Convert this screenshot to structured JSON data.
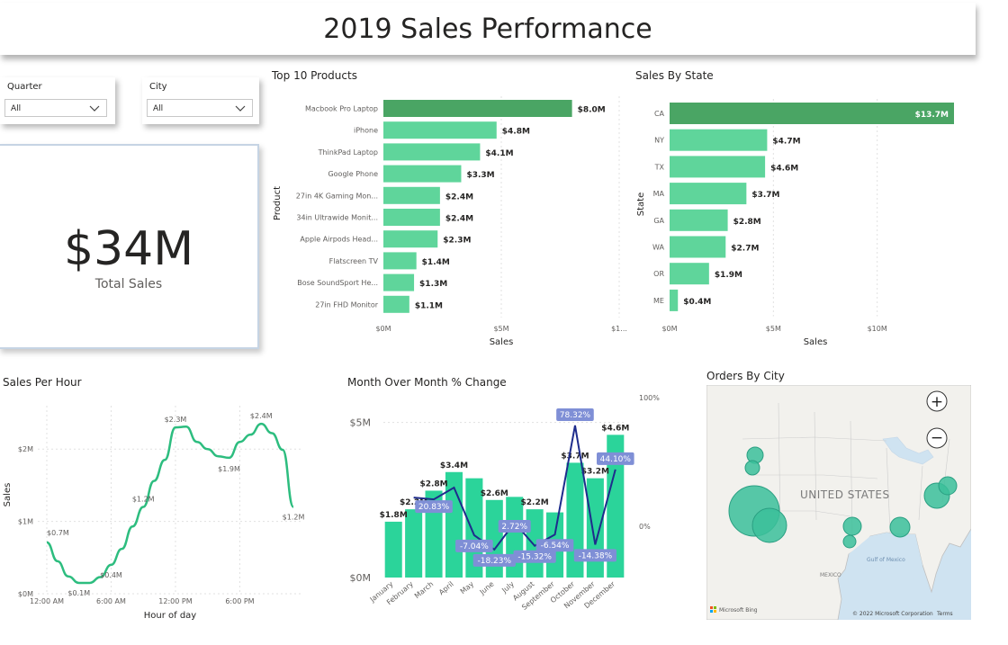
{
  "header": {
    "title": "2019 Sales Performance"
  },
  "slicers": [
    {
      "label": "Quarter",
      "value": "All"
    },
    {
      "label": "City",
      "value": "All"
    }
  ],
  "kpi": {
    "value": "$34M",
    "label": "Total Sales"
  },
  "colors": {
    "top_bar": "#4aa564",
    "bar": "#5fd59b",
    "line": "#2dbd7f",
    "mom_bar": "#2bd49a",
    "mom_line": "#1e2c8c",
    "tag_bg": "#7f8fd6",
    "bubble": "#3bbf9a"
  },
  "chart_data": [
    {
      "type": "bar",
      "orientation": "horizontal",
      "title": "Top 10 Products",
      "xlabel": "Sales",
      "ylabel": "Product",
      "categories": [
        "Macbook Pro Laptop",
        "iPhone",
        "ThinkPad Laptop",
        "Google Phone",
        "27in 4K Gaming Mon...",
        "34in Ultrawide Monit...",
        "Apple Airpods Head...",
        "Flatscreen TV",
        "Bose SoundSport He...",
        "27in FHD Monitor"
      ],
      "values": [
        8.0,
        4.8,
        4.1,
        3.3,
        2.4,
        2.4,
        2.3,
        1.4,
        1.3,
        1.1
      ],
      "data_labels": [
        "$8.0M",
        "$4.8M",
        "$4.1M",
        "$3.3M",
        "$2.4M",
        "$2.4M",
        "$2.3M",
        "$1.4M",
        "$1.3M",
        "$1.1M"
      ],
      "xticks": [
        "$0M",
        "$5M",
        "$1..."
      ],
      "xlim": [
        0,
        10
      ]
    },
    {
      "type": "bar",
      "orientation": "horizontal",
      "title": "Sales By State",
      "xlabel": "Sales",
      "ylabel": "State",
      "categories": [
        "CA",
        "NY",
        "TX",
        "MA",
        "GA",
        "WA",
        "OR",
        "ME"
      ],
      "values": [
        13.7,
        4.7,
        4.6,
        3.7,
        2.8,
        2.7,
        1.9,
        0.4
      ],
      "data_labels": [
        "$13.7M",
        "$4.7M",
        "$4.6M",
        "$3.7M",
        "$2.8M",
        "$2.7M",
        "$1.9M",
        "$0.4M"
      ],
      "xticks": [
        "$0M",
        "$5M",
        "$10M"
      ],
      "xlim": [
        0,
        13.7
      ]
    },
    {
      "type": "line",
      "title": "Sales Per Hour",
      "xlabel": "Hour of day",
      "ylabel": "Sales",
      "x": [
        0,
        1,
        2,
        3,
        4,
        5,
        6,
        7,
        8,
        9,
        10,
        11,
        12,
        13,
        14,
        15,
        16,
        17,
        18,
        19,
        20,
        21,
        22,
        23
      ],
      "values": [
        0.71,
        0.45,
        0.24,
        0.15,
        0.15,
        0.23,
        0.4,
        0.62,
        0.93,
        1.2,
        1.56,
        1.85,
        2.3,
        2.31,
        2.1,
        2.0,
        1.9,
        1.88,
        2.1,
        2.2,
        2.35,
        2.22,
        1.99,
        1.2
      ],
      "point_labels": [
        {
          "x": 0,
          "label": "$0.7M"
        },
        {
          "x": 3,
          "label": "$0.1M"
        },
        {
          "x": 6,
          "label": "$0.4M"
        },
        {
          "x": 9,
          "label": "$1.2M"
        },
        {
          "x": 12,
          "label": "$2.3M"
        },
        {
          "x": 17,
          "label": "$1.9M"
        },
        {
          "x": 20,
          "label": "$2.4M"
        },
        {
          "x": 23,
          "label": "$1.2M"
        }
      ],
      "xticks": [
        "12:00 AM",
        "6:00 AM",
        "12:00 PM",
        "6:00 PM"
      ],
      "yticks": [
        "$0M",
        "$1M",
        "$2M"
      ],
      "ylim": [
        0,
        2.6
      ]
    },
    {
      "type": "bar",
      "title": "Month Over Month % Change",
      "categories": [
        "January",
        "February",
        "March",
        "April",
        "May",
        "June",
        "July",
        "August",
        "September",
        "October",
        "November",
        "December"
      ],
      "values": [
        1.8,
        2.2,
        2.8,
        3.4,
        3.2,
        2.5,
        2.6,
        2.2,
        2.1,
        3.7,
        3.2,
        4.6
      ],
      "data_labels": [
        {
          "month": "January",
          "label": "$1.8M"
        },
        {
          "month": "February",
          "label": "$2.2M"
        },
        {
          "month": "March",
          "label": "$2.8M"
        },
        {
          "month": "April",
          "label": "$3.4M"
        },
        {
          "month": "June",
          "label": "$2.6M"
        },
        {
          "month": "August",
          "label": "$2.2M"
        },
        {
          "month": "October",
          "label": "$3.7M"
        },
        {
          "month": "November",
          "label": "$3.2M"
        },
        {
          "month": "December",
          "label": "$4.6M"
        }
      ],
      "ylim": [
        0,
        5.8
      ],
      "yticks": [
        "$0M",
        "$5M"
      ],
      "line_series": {
        "name": "% change",
        "values": [
          null,
          22.2,
          20.83,
          30.0,
          -7.04,
          -18.23,
          2.72,
          -15.32,
          -6.54,
          78.32,
          -14.38,
          44.1
        ],
        "labels": [
          "",
          "",
          "20.83%",
          "",
          "-7.04%",
          "-18.23%",
          "2.72%",
          "-15.32%",
          "-6.54%",
          "78.32%",
          "-14.38%",
          "44.10%"
        ],
        "y2ticks": [
          "100%",
          "0%"
        ],
        "y2lim": [
          -40,
          100
        ]
      }
    },
    {
      "type": "map",
      "title": "Orders By City",
      "country_label": "UNITED STATES",
      "gulf_label": "Gulf of Mexico",
      "mexico_label": "MEXICO",
      "attribution": "© 2022 Microsoft Corporation",
      "terms": "Terms",
      "bing": "Microsoft Bing",
      "zoom_in": "+",
      "zoom_out": "−"
    }
  ]
}
